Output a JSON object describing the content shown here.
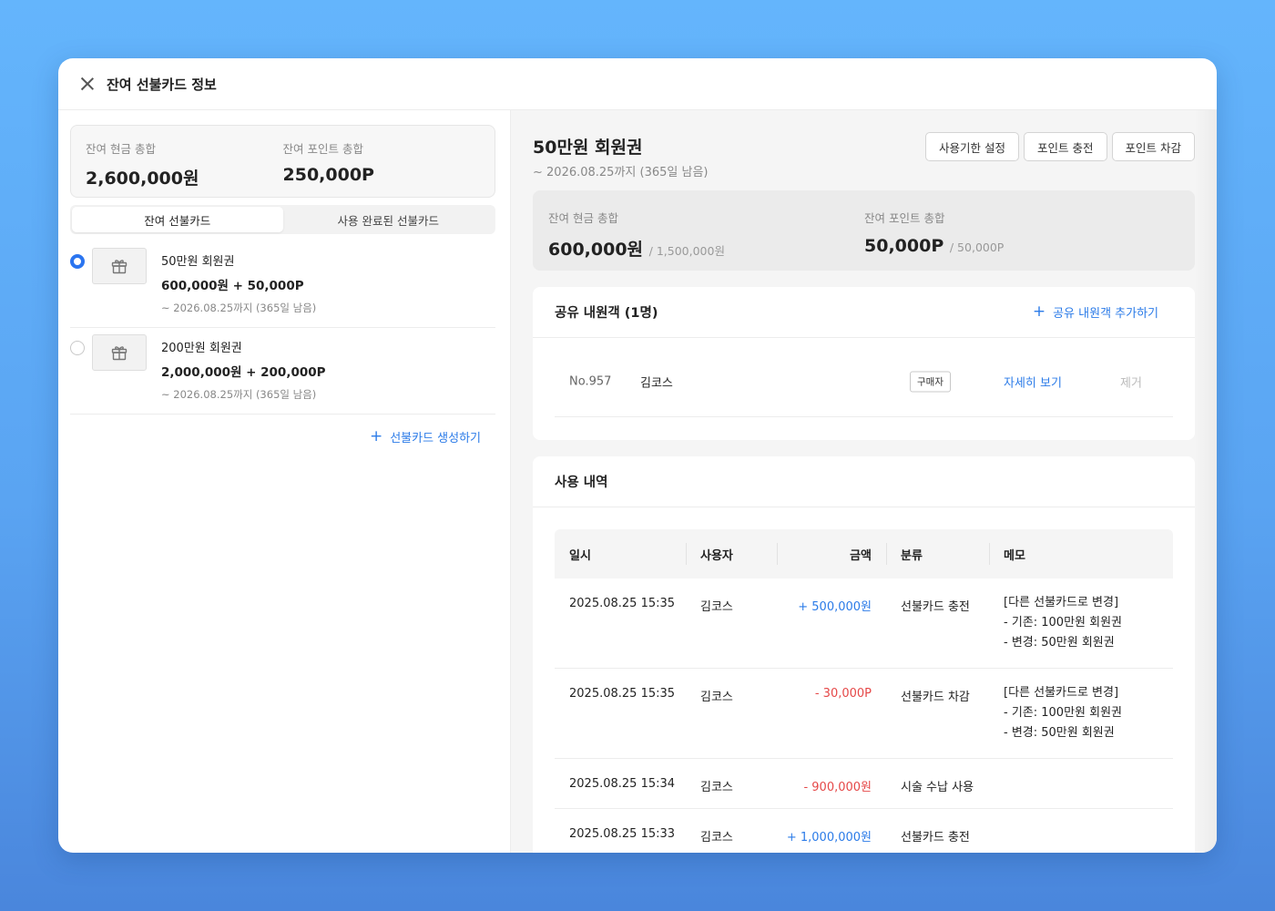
{
  "modal": {
    "title": "잔여 선불카드 정보"
  },
  "left": {
    "summary": {
      "cash_label": "잔여 현금 총합",
      "cash_value": "2,600,000원",
      "point_label": "잔여 포인트 총합",
      "point_value": "250,000P"
    },
    "tabs": [
      {
        "label": "잔여 선불카드",
        "active": true
      },
      {
        "label": "사용 완료된 선불카드",
        "active": false
      }
    ],
    "cards": [
      {
        "name": "50만원 회원권",
        "amount": "600,000원 + 50,000P",
        "expire": "~ 2026.08.25까지 (365일 남음)",
        "selected": true
      },
      {
        "name": "200만원 회원권",
        "amount": "2,000,000원 + 200,000P",
        "expire": "~ 2026.08.25까지 (365일 남음)",
        "selected": false
      }
    ],
    "create_label": "선불카드 생성하기"
  },
  "right": {
    "title": "50만원 회원권",
    "subtitle": "~ 2026.08.25까지 (365일 남음)",
    "buttons": {
      "expire": "사용기한 설정",
      "charge": "포인트 충전",
      "deduct": "포인트 차감"
    },
    "summary": {
      "cash_label": "잔여 현금 총합",
      "cash_value": "600,000원",
      "cash_total": "/ 1,500,000원",
      "point_label": "잔여 포인트 총합",
      "point_value": "50,000P",
      "point_total": "/ 50,000P"
    },
    "shared": {
      "title": "공유 내원객 (1명)",
      "add_label": "공유 내원객 추가하기",
      "members": [
        {
          "no": "No.957",
          "name": "김코스",
          "badge": "구매자",
          "detail": "자세히 보기",
          "remove": "제거"
        }
      ]
    },
    "history": {
      "title": "사용 내역",
      "columns": [
        "일시",
        "사용자",
        "금액",
        "분류",
        "메모"
      ],
      "rows": [
        {
          "date": "2025.08.25 15:35",
          "user": "김코스",
          "amount": "+ 500,000원",
          "category": "선불카드 충전",
          "memo": [
            "[다른 선불카드로 변경]",
            "- 기존: 100만원 회원권",
            "- 변경: 50만원 회원권"
          ]
        },
        {
          "date": "2025.08.25 15:35",
          "user": "김코스",
          "amount": "- 30,000P",
          "category": "선불카드 차감",
          "memo": [
            "[다른 선불카드로 변경]",
            "- 기존: 100만원 회원권",
            "- 변경: 50만원 회원권"
          ]
        },
        {
          "date": "2025.08.25 15:34",
          "user": "김코스",
          "amount": "- 900,000원",
          "category": "시술 수납 사용",
          "memo": []
        },
        {
          "date": "2025.08.25 15:33",
          "user": "김코스",
          "amount": "+ 1,000,000원",
          "category": "선불카드 충전",
          "memo": []
        }
      ]
    }
  },
  "colors": {
    "accent": "#2b7be8",
    "negative": "#e54848",
    "background": "#64b5fc"
  },
  "icons": {
    "close": "close-icon",
    "gift": "gift-icon",
    "plus": "plus-icon"
  }
}
